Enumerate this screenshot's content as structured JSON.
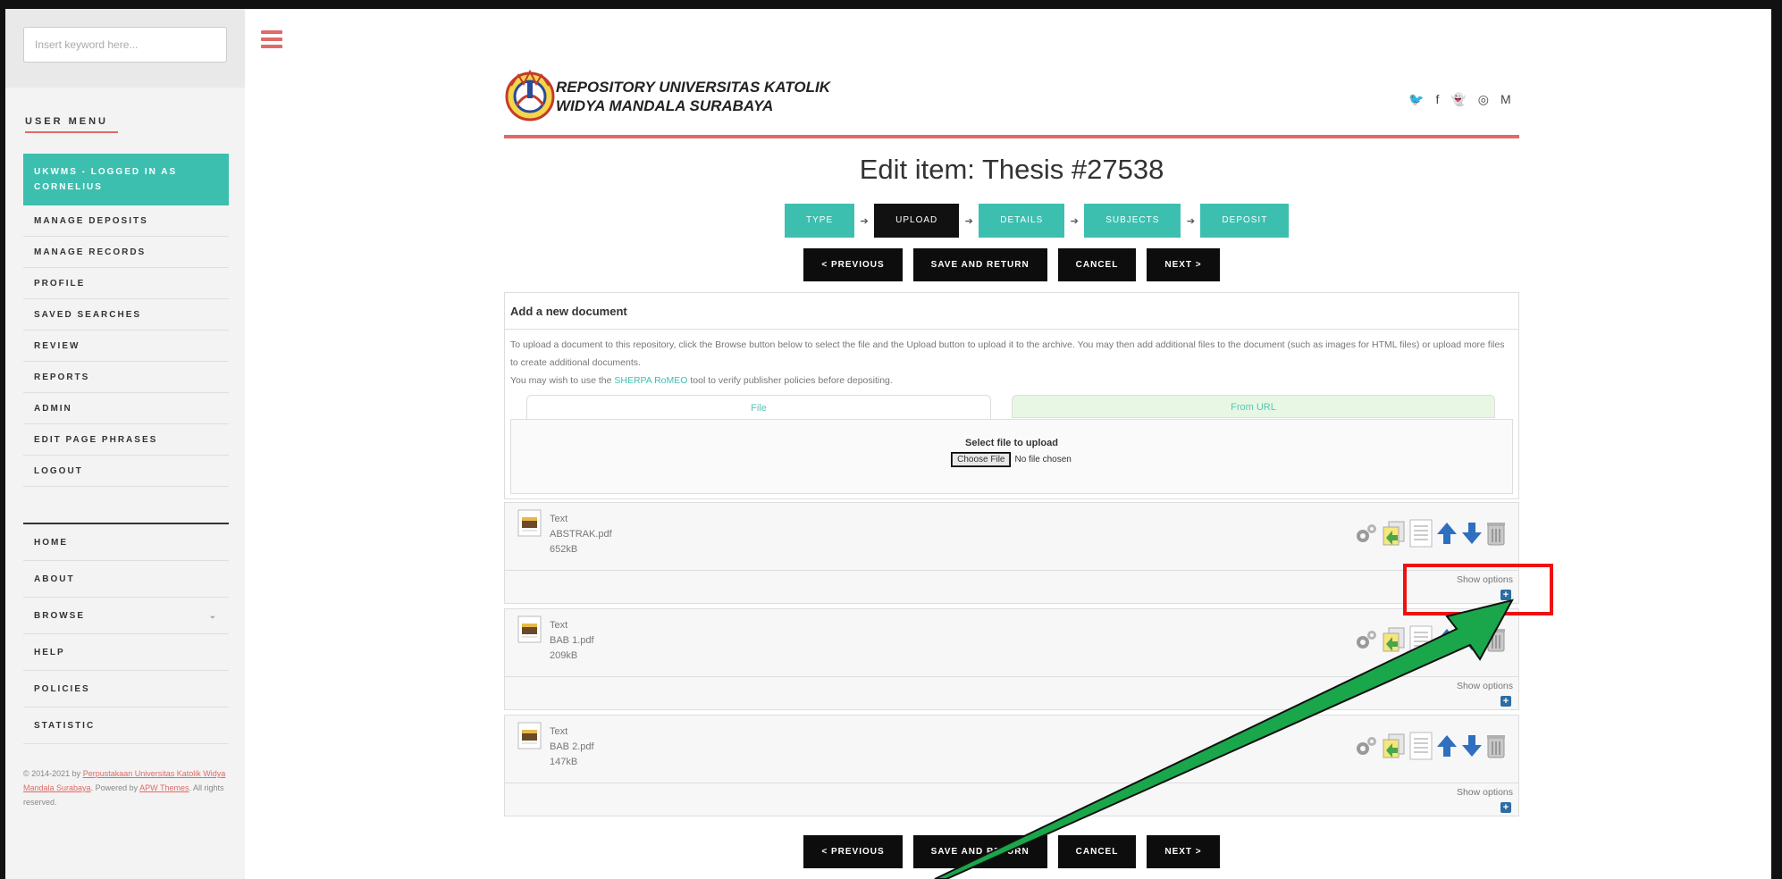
{
  "search": {
    "placeholder": "Insert keyword here..."
  },
  "sidebar": {
    "heading": "USER MENU",
    "user_items": [
      {
        "label_line1": "UKWMS - LOGGED IN AS",
        "label_line2": "CORNELIUS"
      },
      {
        "label": "MANAGE DEPOSITS"
      },
      {
        "label": "MANAGE RECORDS"
      },
      {
        "label": "PROFILE"
      },
      {
        "label": "SAVED SEARCHES"
      },
      {
        "label": "REVIEW"
      },
      {
        "label": "REPORTS"
      },
      {
        "label": "ADMIN"
      },
      {
        "label": "EDIT PAGE PHRASES"
      },
      {
        "label": "LOGOUT"
      }
    ],
    "nav_items": [
      {
        "label": "HOME"
      },
      {
        "label": "ABOUT"
      },
      {
        "label": "BROWSE",
        "chevron": "⌄"
      },
      {
        "label": "HELP"
      },
      {
        "label": "POLICIES"
      },
      {
        "label": "STATISTIC"
      }
    ],
    "footer": {
      "prefix": "© 2014-2021 by ",
      "link1": "Perpustakaan Universitas Katolik Widya Mandala Surabaya",
      "middle": ". Powered by ",
      "link2": "APW Themes",
      "suffix": ". All rights reserved."
    }
  },
  "header": {
    "title_line1": "REPOSITORY UNIVERSITAS KATOLIK",
    "title_line2": "WIDYA MANDALA SURABAYA",
    "social_icons": [
      "twitter-icon",
      "facebook-icon",
      "snapchat-icon",
      "instagram-icon",
      "mendeley-icon"
    ],
    "social_glyphs": [
      "🐦",
      "f",
      "👻",
      "◎",
      "M"
    ]
  },
  "page": {
    "title": "Edit item: Thesis #27538",
    "steps": [
      "TYPE",
      "UPLOAD",
      "DETAILS",
      "SUBJECTS",
      "DEPOSIT"
    ],
    "step_arrow": "➔",
    "buttons": {
      "previous": "< PREVIOUS",
      "save_return": "SAVE AND RETURN",
      "cancel": "CANCEL",
      "next": "NEXT >"
    }
  },
  "add_document": {
    "title": "Add a new document",
    "desc_line1": "To upload a document to this repository, click the Browse button below to select the file and the Upload button to upload it to the archive. You may then add additional files to the document (such as images for HTML files) or upload more files to create additional documents.",
    "desc_line2_prefix": "You may wish to use the ",
    "desc_link": "SHERPA RoMEO",
    "desc_line2_suffix": " tool to verify publisher policies before depositing.",
    "tab_file": "File",
    "tab_url": "From URL",
    "upload_label": "Select file to upload",
    "choose_button": "Choose File",
    "no_file": "No file chosen"
  },
  "files": [
    {
      "type": "Text",
      "name": "ABSTRAK.pdf",
      "size": "652kB",
      "options": "Show options",
      "plus": "+"
    },
    {
      "type": "Text",
      "name": "BAB 1.pdf",
      "size": "209kB",
      "options": "Show options",
      "plus": "+"
    },
    {
      "type": "Text",
      "name": "BAB 2.pdf",
      "size": "147kB",
      "options": "Show options",
      "plus": "+"
    }
  ],
  "colors": {
    "accent": "#3dbfb0",
    "brand_red": "#e06a66",
    "highlight_red": "#ee1111",
    "arrow_green": "#1aa64a"
  }
}
